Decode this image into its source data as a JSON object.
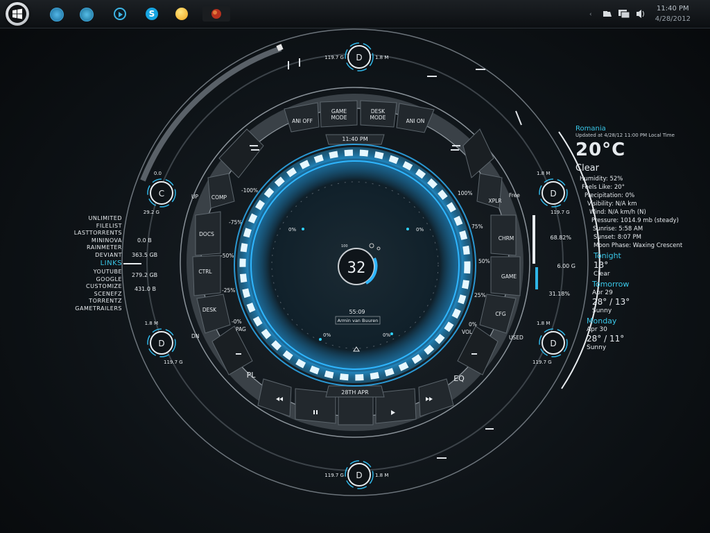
{
  "taskbar": {
    "clock_time": "11:40 PM",
    "clock_date": "4/28/2012",
    "icons": [
      "windows-logo-icon",
      "ie-icon",
      "window-icon",
      "media-play-icon",
      "skype-icon",
      "messenger-smiley-icon",
      "app-icon"
    ]
  },
  "center": {
    "time": "11:40  PM",
    "date": "28TH  APR",
    "level": "32",
    "level_small": "100",
    "track_time": "55:09",
    "track_artist": "Armin van Buuren",
    "buttons_top": [
      "ANI OFF",
      "GAME\nMODE",
      "DESK\nMODE",
      "ANI ON"
    ],
    "buttons_left": [
      "COMP",
      "DOCS",
      "CTRL",
      "DESK"
    ],
    "buttons_right": [
      "XPLR",
      "CHRM",
      "GAME",
      "CFG"
    ],
    "buttons_bottom": [
      "PL",
      "EQ"
    ],
    "scale_left": [
      "-100%",
      "-75%",
      "-50%",
      "-25%",
      "-0%"
    ],
    "scale_right": [
      "100%",
      "75%",
      "50%",
      "25%",
      "0%"
    ],
    "side_labels": {
      "up": "UP",
      "dn": "DN",
      "pag": "PAG",
      "vol": "VOL",
      "free": "Free",
      "used": "USED"
    },
    "inner_percent": [
      "0%",
      "0%",
      "0%",
      "0%"
    ]
  },
  "drives": {
    "top": {
      "letter": "D",
      "left": "119.7 G",
      "right": "1.8 M"
    },
    "bottom": {
      "letter": "D",
      "left": "119.7 G",
      "right": "1.8 M"
    },
    "left_c": {
      "letter": "C",
      "top": "0.0",
      "bottom": "29.2 G"
    },
    "left_d": {
      "letter": "D",
      "top": "1.8 M",
      "bottom": "119.7 G"
    },
    "right_top": {
      "letter": "D",
      "top": "1.8 M",
      "bottom": "119.7 G"
    },
    "right_bottom": {
      "letter": "D",
      "top": "1.8 M",
      "bottom": "119.7 G"
    }
  },
  "links": {
    "items": [
      "UNLIMITED",
      "FILELIST",
      "LASTTORRENTS",
      "MININOVA",
      "RAINMETER",
      "DEVIANT"
    ],
    "title": "LINKS",
    "items2": [
      "YOUTUBE",
      "GOOGLE",
      "CUSTOMIZE",
      "SCENEFZ",
      "TORRENTZ",
      "GAMETRAILERS"
    ]
  },
  "left_stats": [
    "0.0 B",
    "363.5 GB",
    "279.2 GB",
    "431.0 B"
  ],
  "right_stats": [
    "68.82%",
    "6.00 G",
    "31.18%"
  ],
  "weather": {
    "location": "Romania",
    "updated": "Updated at 4/28/12 11:00 PM Local Time",
    "temp": "20°C",
    "condition": "Clear",
    "details": [
      "Humidity: 52%",
      "Feels Like: 20°",
      "Precipitation: 0%",
      "Visibility: N/A km",
      "Wind: N/A km/h (N)",
      "Pressure: 1014.9 mb (steady)",
      "Sunrise: 5:58 AM",
      "Sunset: 8:07 PM",
      "Moon Phase: Waxing Crescent"
    ],
    "tonight_label": "Tonight",
    "tonight_temp": "13°",
    "tonight_cond": "Clear",
    "tomorrow_label": "Tomorrow",
    "tomorrow_date": "Apr 29",
    "tomorrow_temp": "28° / 13°",
    "tomorrow_cond": "Sunny",
    "monday_label": "Monday",
    "monday_date": "Apr 30",
    "monday_temp": "28° / 11°",
    "monday_cond": "Sunny"
  },
  "colors": {
    "accent": "#39c7e8",
    "ring_glow": "#2fb6ff",
    "text": "#e8ecef",
    "bg": "#0e1317"
  }
}
